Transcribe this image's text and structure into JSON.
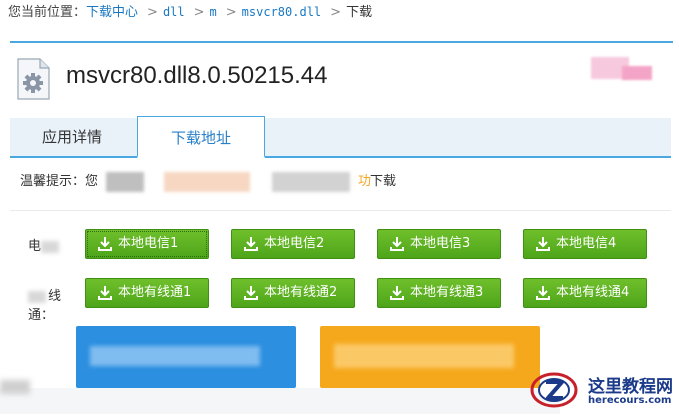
{
  "breadcrumb": {
    "lead": "您当前位置：",
    "items": [
      "下载中心",
      "dll",
      "m",
      "msvcr80.dll"
    ],
    "current": "下载",
    "separator": ">"
  },
  "file": {
    "icon": "dll-gear-file-icon",
    "title": "msvcr80.dll8.0.50215.44"
  },
  "tabs": [
    {
      "label": "应用详情",
      "active": false
    },
    {
      "label": "下载地址",
      "active": true
    }
  ],
  "notice": {
    "lead": "温馨提示：您",
    "orange_fragment": "功",
    "tail": "下载"
  },
  "rows": [
    {
      "label": "电",
      "buttons": [
        "本地电信1",
        "本地电信2",
        "本地电信3",
        "本地电信4"
      ]
    },
    {
      "label": "线通：",
      "buttons": [
        "本地有线通1",
        "本地有线通2",
        "本地有线通3",
        "本地有线通4"
      ]
    }
  ],
  "download_icon": "download-arrow-icon",
  "watermark": {
    "name": "这里教程网",
    "url": "herecours.com"
  },
  "colors": {
    "accent_blue": "#4aa8e0",
    "link_blue": "#1a78c2",
    "button_green": "#5cb021",
    "big_blue": "#2d8fe0",
    "big_orange": "#f6a81c",
    "notice_orange": "#f5a623"
  }
}
